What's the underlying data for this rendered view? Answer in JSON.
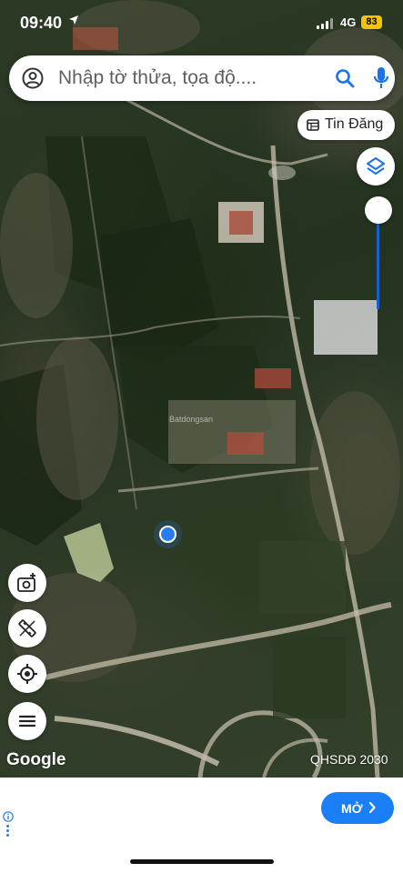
{
  "status_bar": {
    "time": "09:40",
    "location_arrow": "location-arrow-icon",
    "network": "4G",
    "battery": "83"
  },
  "search": {
    "placeholder": "Nhập tờ thửa, tọa độ....",
    "value": ""
  },
  "tin_dang": {
    "label": "Tin Đăng"
  },
  "watermark": {
    "text": "Batdongsan"
  },
  "map": {
    "attribution": "Google",
    "layer_label": "QHSDĐ 2030"
  },
  "left_buttons": [
    {
      "name": "add-photo-location-icon"
    },
    {
      "name": "measure-tool-icon"
    },
    {
      "name": "my-location-icon"
    },
    {
      "name": "menu-icon"
    }
  ],
  "ad": {
    "open_label": "MỞ"
  },
  "colors": {
    "accent": "#1a7ff5",
    "location_dot": "#2a7df0",
    "battery": "#f2c500",
    "slider_track": "#1a5fd0"
  },
  "opacity_slider": {
    "level": 0.0
  }
}
